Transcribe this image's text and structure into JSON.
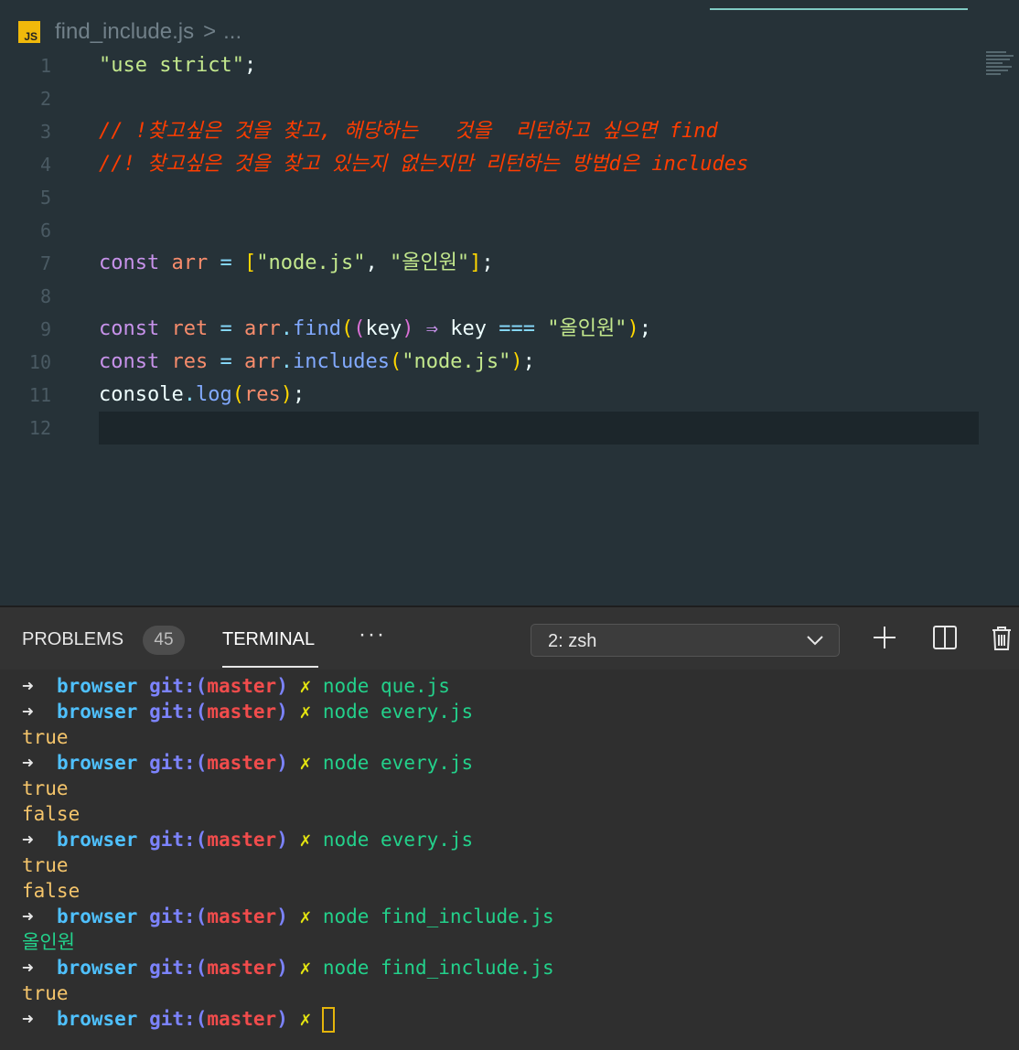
{
  "editor": {
    "breadcrumb": {
      "icon": "JS",
      "file": "find_include.js",
      "separator": ">",
      "ellipsis": "..."
    },
    "lines": [
      {
        "n": "1"
      },
      {
        "n": "2"
      },
      {
        "n": "3"
      },
      {
        "n": "4"
      },
      {
        "n": "5"
      },
      {
        "n": "6"
      },
      {
        "n": "7"
      },
      {
        "n": "8"
      },
      {
        "n": "9"
      },
      {
        "n": "10"
      },
      {
        "n": "11"
      },
      {
        "n": "12"
      }
    ],
    "code": {
      "l1_str": "\"use strict\"",
      "l1_semi": ";",
      "l3_comment": "// !찾고싶은 것을 찾고, 해당하는   것을  리턴하고 싶으면 find",
      "l4_comment": "//! 찾고싶은 것을 찾고 있는지 없는지만 리턴하는 방법d은 includes",
      "const": "const",
      "arr": "arr",
      "ret": "ret",
      "res": "res",
      "eq": "=",
      "lbracket": "[",
      "rbracket": "]",
      "str_node": "\"node.js\"",
      "str_allinone": "\"올인원\"",
      "comma": ",",
      "semi": ";",
      "dot": ".",
      "find": "find",
      "includes": "includes",
      "console": "console",
      "log": "log",
      "lparen": "(",
      "rparen": ")",
      "key": "key",
      "arrow": "⇒",
      "strict_eq": "===",
      "space": " "
    }
  },
  "panel": {
    "problems_label": "PROBLEMS",
    "problems_count": "45",
    "terminal_label": "TERMINAL",
    "more_label": "···",
    "shell_selected": "2: zsh"
  },
  "terminal": {
    "arrow": "➜",
    "dir": "browser",
    "git_prefix": "git:(",
    "branch": "master",
    "git_suffix": ")",
    "dirty": "✗",
    "entries": [
      {
        "cmd": "node que.js",
        "outputs": []
      },
      {
        "cmd": "node every.js",
        "outputs": [
          "true"
        ]
      },
      {
        "cmd": "node every.js",
        "outputs": [
          "true",
          "false"
        ]
      },
      {
        "cmd": "node every.js",
        "outputs": [
          "true",
          "false"
        ]
      },
      {
        "cmd": "node find_include.js",
        "outputs": [
          "올인원"
        ]
      },
      {
        "cmd": "node find_include.js",
        "outputs": [
          "true"
        ]
      }
    ]
  },
  "colors": {
    "editor_bg": "#263238",
    "terminal_bg": "#2f2f2f",
    "comment": "#ff3d00",
    "keyword": "#c792ea",
    "string": "#c3e88d"
  }
}
